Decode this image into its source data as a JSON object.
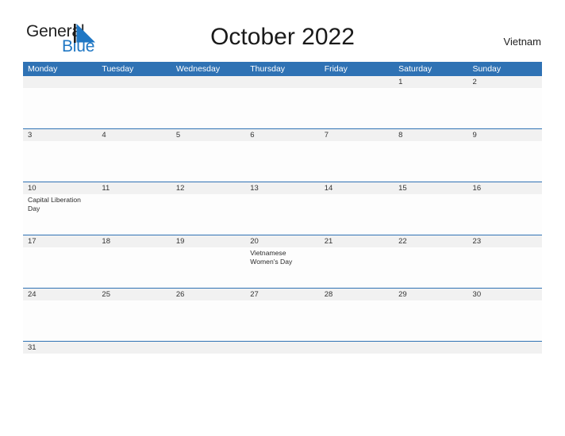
{
  "brand": {
    "name_part1": "General",
    "name_part2": "Blue",
    "flag_icon": "blue-pennant-icon"
  },
  "header": {
    "title": "October 2022",
    "country": "Vietnam"
  },
  "colors": {
    "header_blue": "#2f72b4",
    "brand_blue": "#1f77c4",
    "date_band_gray": "#f1f1f1",
    "row_rule_blue": "#2f72b4",
    "text_dark": "#222222"
  },
  "weekdays": [
    "Monday",
    "Tuesday",
    "Wednesday",
    "Thursday",
    "Friday",
    "Saturday",
    "Sunday"
  ],
  "weeks": [
    {
      "short": false,
      "days": [
        {
          "date": "",
          "event": ""
        },
        {
          "date": "",
          "event": ""
        },
        {
          "date": "",
          "event": ""
        },
        {
          "date": "",
          "event": ""
        },
        {
          "date": "",
          "event": ""
        },
        {
          "date": "1",
          "event": ""
        },
        {
          "date": "2",
          "event": ""
        }
      ]
    },
    {
      "short": false,
      "days": [
        {
          "date": "3",
          "event": ""
        },
        {
          "date": "4",
          "event": ""
        },
        {
          "date": "5",
          "event": ""
        },
        {
          "date": "6",
          "event": ""
        },
        {
          "date": "7",
          "event": ""
        },
        {
          "date": "8",
          "event": ""
        },
        {
          "date": "9",
          "event": ""
        }
      ]
    },
    {
      "short": false,
      "days": [
        {
          "date": "10",
          "event": "Capital Liberation Day"
        },
        {
          "date": "11",
          "event": ""
        },
        {
          "date": "12",
          "event": ""
        },
        {
          "date": "13",
          "event": ""
        },
        {
          "date": "14",
          "event": ""
        },
        {
          "date": "15",
          "event": ""
        },
        {
          "date": "16",
          "event": ""
        }
      ]
    },
    {
      "short": false,
      "days": [
        {
          "date": "17",
          "event": ""
        },
        {
          "date": "18",
          "event": ""
        },
        {
          "date": "19",
          "event": ""
        },
        {
          "date": "20",
          "event": "Vietnamese Women's Day"
        },
        {
          "date": "21",
          "event": ""
        },
        {
          "date": "22",
          "event": ""
        },
        {
          "date": "23",
          "event": ""
        }
      ]
    },
    {
      "short": false,
      "days": [
        {
          "date": "24",
          "event": ""
        },
        {
          "date": "25",
          "event": ""
        },
        {
          "date": "26",
          "event": ""
        },
        {
          "date": "27",
          "event": ""
        },
        {
          "date": "28",
          "event": ""
        },
        {
          "date": "29",
          "event": ""
        },
        {
          "date": "30",
          "event": ""
        }
      ]
    },
    {
      "short": true,
      "days": [
        {
          "date": "31",
          "event": ""
        },
        {
          "date": "",
          "event": ""
        },
        {
          "date": "",
          "event": ""
        },
        {
          "date": "",
          "event": ""
        },
        {
          "date": "",
          "event": ""
        },
        {
          "date": "",
          "event": ""
        },
        {
          "date": "",
          "event": ""
        }
      ]
    }
  ]
}
